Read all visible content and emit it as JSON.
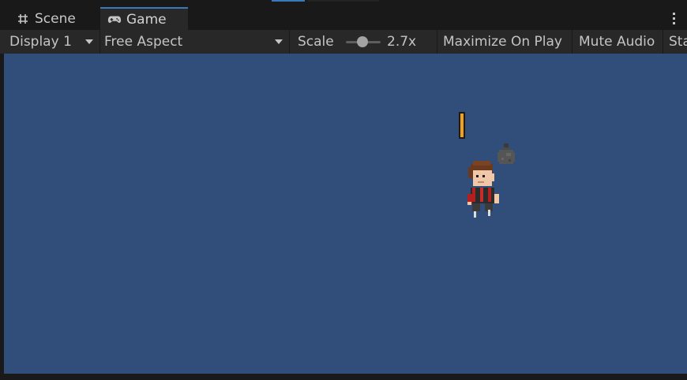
{
  "tabs": [
    {
      "label": "Scene",
      "icon": "grid-hash-icon",
      "active": false
    },
    {
      "label": "Game",
      "icon": "gamepad-icon",
      "active": true
    }
  ],
  "toolbar": {
    "display": "Display 1",
    "aspect": "Free Aspect",
    "scale_label": "Scale",
    "scale_value": "2.7x",
    "maximize": "Maximize On Play",
    "mute": "Mute Audio",
    "stats": "Stats"
  },
  "game_view": {
    "background_color": "#314d79",
    "gauge_fill_fraction": 1.0,
    "gauge_color": "#f2a21a"
  },
  "colors": {
    "accent": "#3a79bb",
    "panel": "#282828",
    "frame": "#191919"
  }
}
